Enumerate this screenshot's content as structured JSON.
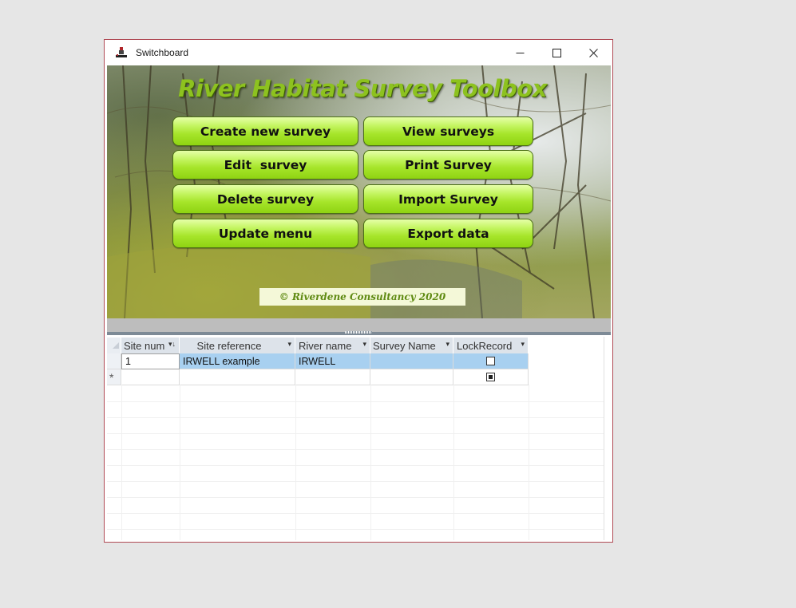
{
  "window": {
    "title": "Switchboard",
    "icon": "access-form-icon",
    "controls": [
      "minimize-icon",
      "maximize-icon",
      "close-icon"
    ]
  },
  "hero": {
    "title": "River Habitat Survey Toolbox",
    "copyright": "© Riverdene Consultancy 2020"
  },
  "menu": {
    "create_new_survey": "Create new survey",
    "view_surveys": "View surveys",
    "edit_survey": "Edit  survey",
    "print_survey": "Print Survey",
    "delete_survey": "Delete survey",
    "import_survey": "Import Survey",
    "update_menu": "Update menu",
    "export_data": "Export data"
  },
  "colors": {
    "button_green": "#a6e52a",
    "title_green": "#8dc21f",
    "selected_row": "#a8d0f0",
    "window_border": "#b04a55"
  },
  "datasheet": {
    "columns": [
      {
        "label": "Site num",
        "sort_icon": "sort-ascending-icon"
      },
      {
        "label": "Site reference",
        "sort_icon": "dropdown-arrow-icon"
      },
      {
        "label": "River name",
        "sort_icon": "dropdown-arrow-icon"
      },
      {
        "label": "Survey Name",
        "sort_icon": "dropdown-arrow-icon"
      },
      {
        "label": "LockRecord",
        "sort_icon": "dropdown-arrow-icon"
      }
    ],
    "rows": [
      {
        "site_num": "1",
        "site_reference": "IRWELL example",
        "river_name": "IRWELL",
        "survey_name": "",
        "lock_record": false
      }
    ],
    "new_row": {
      "selector": "*",
      "lock_record": true
    }
  }
}
